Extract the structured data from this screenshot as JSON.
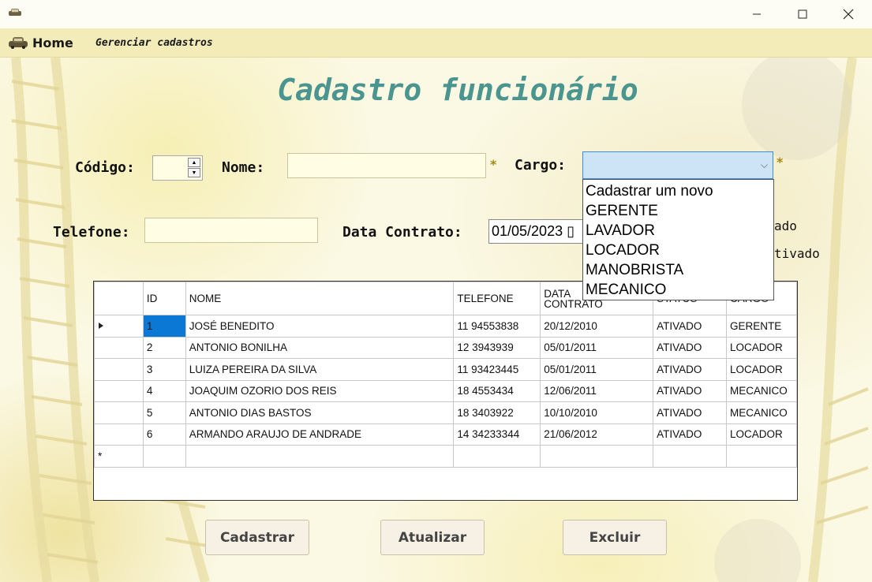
{
  "window": {
    "app_icon": "car-icon",
    "controls": [
      "minimize-icon",
      "maximize-icon",
      "close-icon"
    ]
  },
  "menu": {
    "home_label": "Home",
    "home_icon": "car-icon",
    "manage_label": "Gerenciar cadastros"
  },
  "form": {
    "title": "Cadastro funcionário",
    "codigo_label": "Código:",
    "nome_label": "Nome:",
    "cargo_label": "Cargo:",
    "telefone_label": "Telefone:",
    "data_label": "Data Contrato:",
    "data_value": "01/05/2023",
    "required_marker": "*",
    "codigo_value": "",
    "nome_value": "",
    "telefone_value": "",
    "cargo_value": "",
    "radio1_partial": "ado",
    "radio2_partial": "tivado"
  },
  "cargo_options": [
    "Cadastrar um novo",
    "GERENTE",
    "LAVADOR",
    "LOCADOR",
    "MANOBRISTA",
    "MECANICO"
  ],
  "grid": {
    "headers": {
      "id": "ID",
      "nome": "NOME",
      "telefone": "TELEFONE",
      "data1": "DATA",
      "data2": "CONTRATO",
      "status": "STATUS",
      "cargo": "CARGO"
    },
    "rows": [
      {
        "id": "1",
        "nome": "JOSÉ BENEDITO",
        "telefone": "11 94553838",
        "data": "20/12/2010",
        "status": "ATIVADO",
        "cargo": "GERENTE"
      },
      {
        "id": "2",
        "nome": "ANTONIO BONILHA",
        "telefone": "12 3943939",
        "data": "05/01/2011",
        "status": "ATIVADO",
        "cargo": "LOCADOR"
      },
      {
        "id": "3",
        "nome": "LUIZA PEREIRA DA SILVA",
        "telefone": "11 93423445",
        "data": "05/01/2011",
        "status": "ATIVADO",
        "cargo": "LOCADOR"
      },
      {
        "id": "4",
        "nome": "JOAQUIM OZORIO DOS REIS",
        "telefone": "18 4553434",
        "data": "12/06/2011",
        "status": "ATIVADO",
        "cargo": "MECANICO"
      },
      {
        "id": "5",
        "nome": "ANTONIO DIAS BASTOS",
        "telefone": "18 3403922",
        "data": "10/10/2010",
        "status": "ATIVADO",
        "cargo": "MECANICO"
      },
      {
        "id": "6",
        "nome": "ARMANDO ARAUJO DE ANDRADE",
        "telefone": "14 34233344",
        "data": "21/06/2012",
        "status": "ATIVADO",
        "cargo": "LOCADOR"
      }
    ],
    "new_row_marker": "*"
  },
  "buttons": {
    "cadastrar": "Cadastrar",
    "atualizar": "Atualizar",
    "excluir": "Excluir"
  },
  "colors": {
    "title": "#4a958f",
    "menubar": "#f3ecb8",
    "field_bg": "#fffde3",
    "selection": "#0a78d4",
    "combo_focus": "#cde4f7"
  }
}
